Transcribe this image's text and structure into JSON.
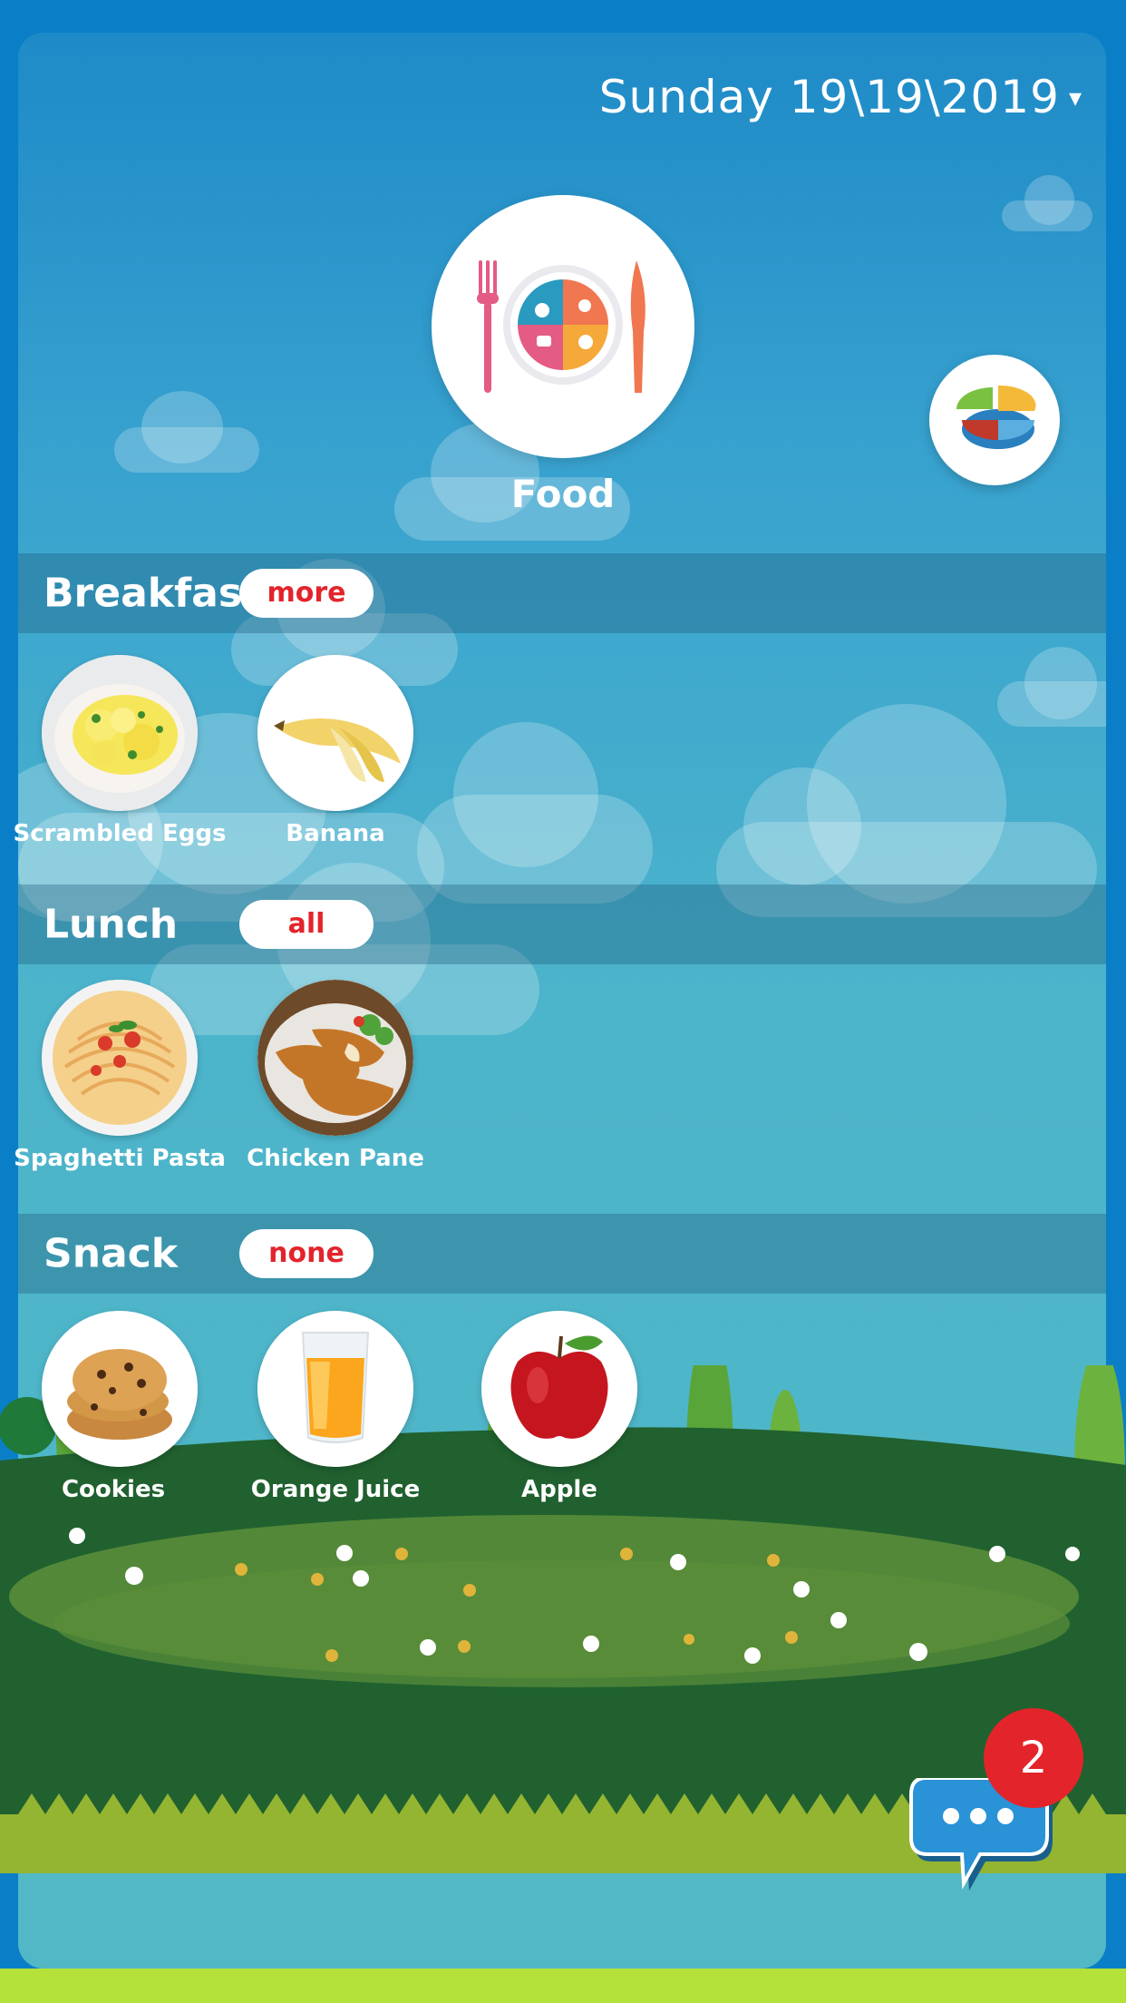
{
  "header": {
    "date_text": "Sunday 19\\19\\2019",
    "date_caret": "▾"
  },
  "hero": {
    "title": "Food",
    "icon": "plate-with-fork-knife-icon"
  },
  "chart_button_icon": "pie-chart-icon",
  "sections": [
    {
      "title": "Breakfast",
      "pill": "more",
      "items": [
        {
          "label": "Scrambled Eggs",
          "icon": "scrambled-eggs-icon"
        },
        {
          "label": "Banana",
          "icon": "banana-icon"
        }
      ]
    },
    {
      "title": "Lunch",
      "pill": "all",
      "items": [
        {
          "label": "Spaghetti Pasta",
          "icon": "spaghetti-icon"
        },
        {
          "label": "Chicken Pane",
          "icon": "chicken-pane-icon"
        }
      ]
    },
    {
      "title": "Snack",
      "pill": "none",
      "items": [
        {
          "label": "Cookies",
          "icon": "cookies-icon"
        },
        {
          "label": "Orange Juice",
          "icon": "orange-juice-icon"
        },
        {
          "label": "Apple",
          "icon": "apple-icon"
        }
      ]
    }
  ],
  "chat": {
    "icon": "chat-bubble-icon",
    "badge_count": "2"
  },
  "colors": {
    "accent_red": "#e3242b",
    "sky": "#4cb4cb",
    "grass_dark": "#20612f",
    "grass_light": "#94b531"
  }
}
